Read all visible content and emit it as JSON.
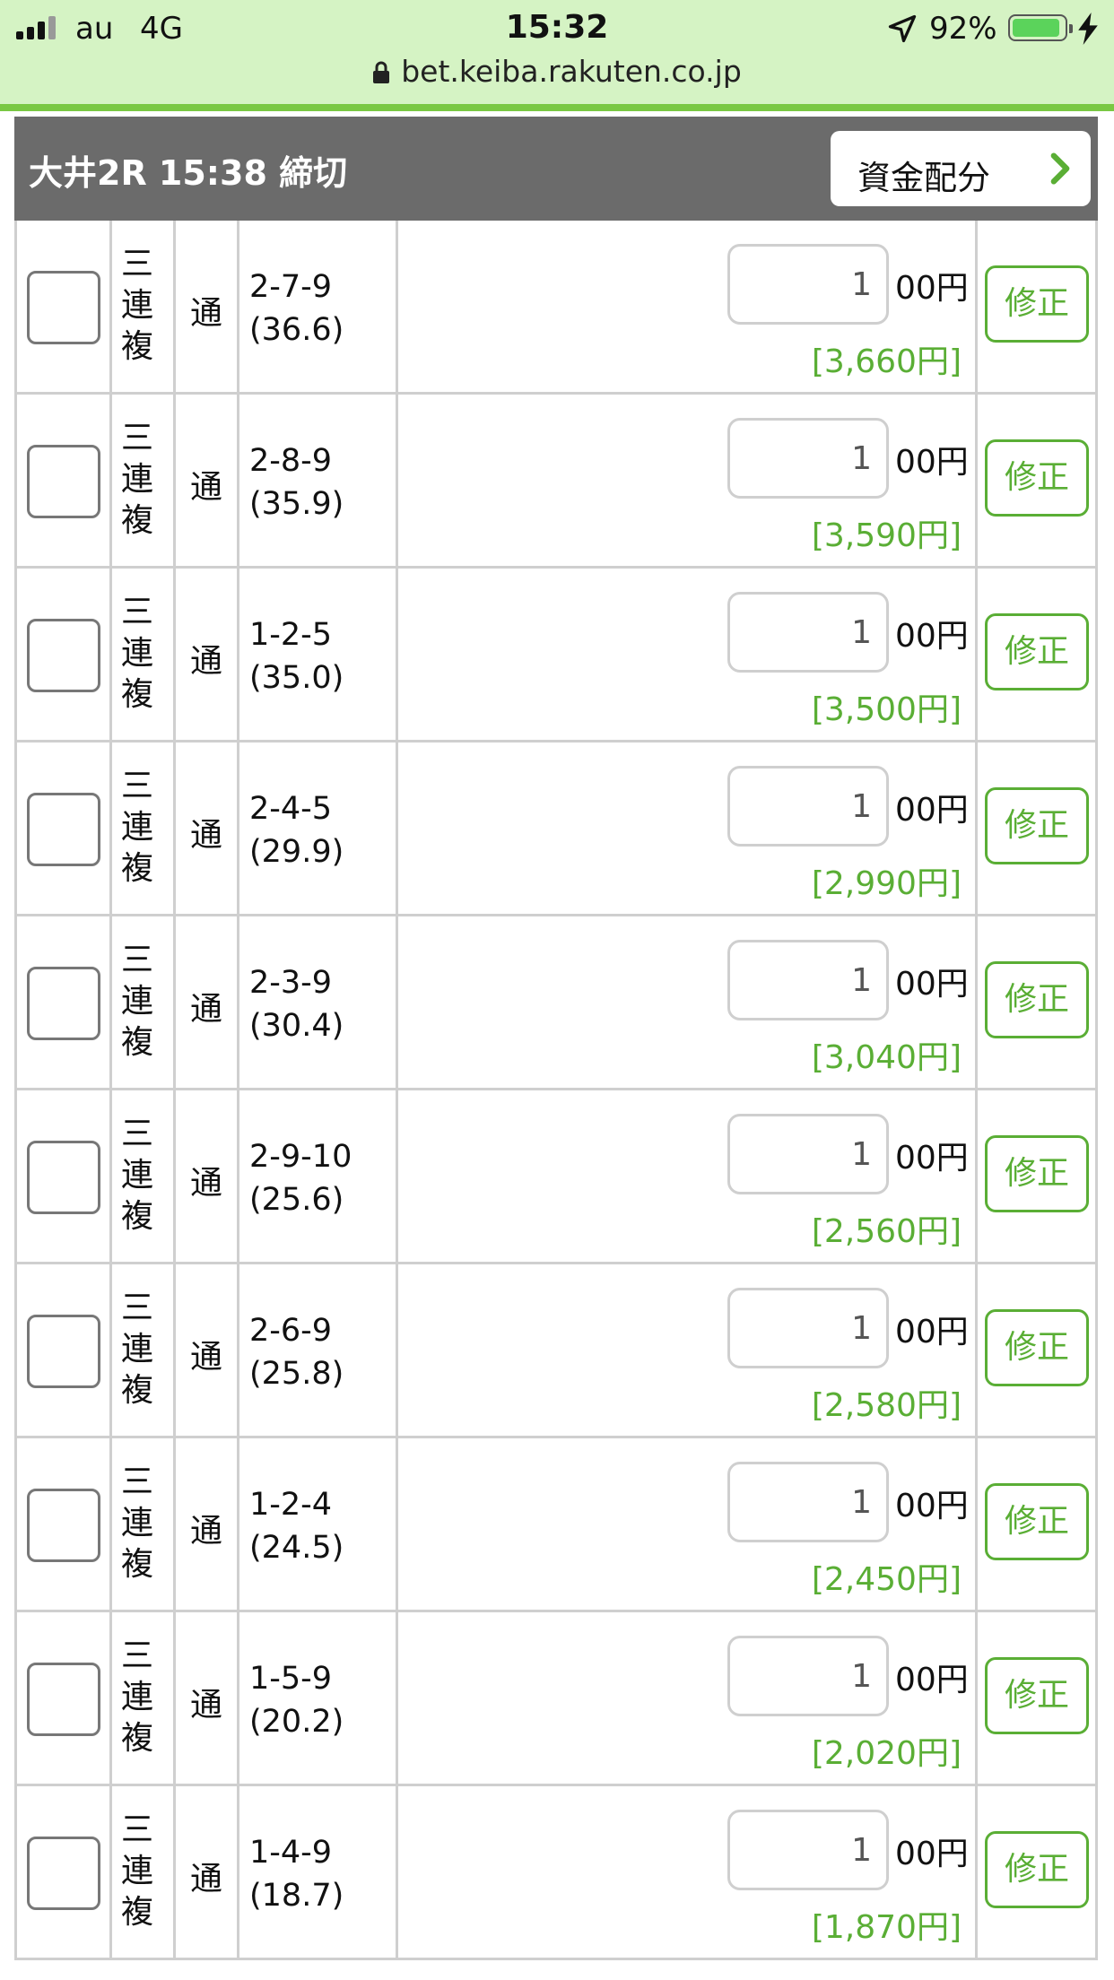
{
  "status_bar": {
    "carrier": "au",
    "network": "4G",
    "time": "15:32",
    "battery_percent": "92%",
    "battery_level": 0.92
  },
  "browser": {
    "url": "bet.keiba.rakuten.co.jp"
  },
  "race_header": {
    "title": "大井2R 15:38 締切",
    "allocation_button": "資金配分"
  },
  "bets": [
    {
      "type": "三連複",
      "method": "通",
      "numbers": "2-7-9",
      "odds": "(36.6)",
      "units": "1",
      "unit_suffix": "00円",
      "payout": "[3,660円]",
      "edit": "修正"
    },
    {
      "type": "三連複",
      "method": "通",
      "numbers": "2-8-9",
      "odds": "(35.9)",
      "units": "1",
      "unit_suffix": "00円",
      "payout": "[3,590円]",
      "edit": "修正"
    },
    {
      "type": "三連複",
      "method": "通",
      "numbers": "1-2-5",
      "odds": "(35.0)",
      "units": "1",
      "unit_suffix": "00円",
      "payout": "[3,500円]",
      "edit": "修正"
    },
    {
      "type": "三連複",
      "method": "通",
      "numbers": "2-4-5",
      "odds": "(29.9)",
      "units": "1",
      "unit_suffix": "00円",
      "payout": "[2,990円]",
      "edit": "修正"
    },
    {
      "type": "三連複",
      "method": "通",
      "numbers": "2-3-9",
      "odds": "(30.4)",
      "units": "1",
      "unit_suffix": "00円",
      "payout": "[3,040円]",
      "edit": "修正"
    },
    {
      "type": "三連複",
      "method": "通",
      "numbers": "2-9-10",
      "odds": "(25.6)",
      "units": "1",
      "unit_suffix": "00円",
      "payout": "[2,560円]",
      "edit": "修正"
    },
    {
      "type": "三連複",
      "method": "通",
      "numbers": "2-6-9",
      "odds": "(25.8)",
      "units": "1",
      "unit_suffix": "00円",
      "payout": "[2,580円]",
      "edit": "修正"
    },
    {
      "type": "三連複",
      "method": "通",
      "numbers": "1-2-4",
      "odds": "(24.5)",
      "units": "1",
      "unit_suffix": "00円",
      "payout": "[2,450円]",
      "edit": "修正"
    },
    {
      "type": "三連複",
      "method": "通",
      "numbers": "1-5-9",
      "odds": "(20.2)",
      "units": "1",
      "unit_suffix": "00円",
      "payout": "[2,020円]",
      "edit": "修正"
    },
    {
      "type": "三連複",
      "method": "通",
      "numbers": "1-4-9",
      "odds": "(18.7)",
      "units": "1",
      "unit_suffix": "00円",
      "payout": "[1,870円]",
      "edit": "修正"
    }
  ],
  "colors": {
    "accent_green": "#5aae35",
    "header_gray": "#6b6b6b",
    "url_bar_green": "#d5f3c4"
  }
}
